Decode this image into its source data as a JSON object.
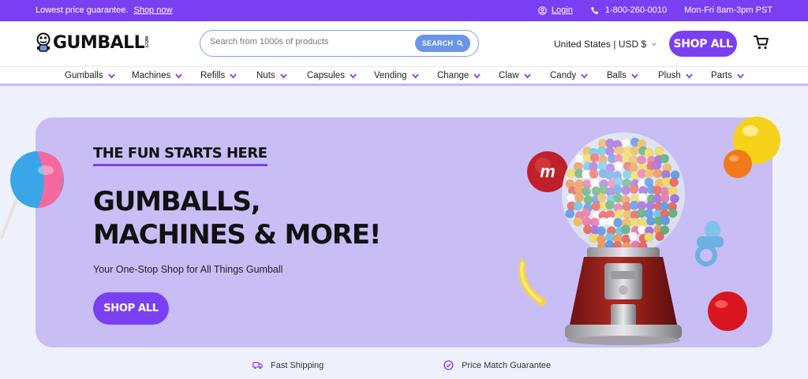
{
  "topbar": {
    "promo_text": "Lowest price guarantee.",
    "promo_link": "Shop now",
    "login": "Login",
    "phone": "1-800-260-0010",
    "hours": "Mon-Fri 8am-3pm PST"
  },
  "header": {
    "logo_text": "GUMBALL",
    "logo_suffix": ".COM",
    "search_placeholder": "Search from 1000s of products",
    "search_button": "SEARCH",
    "region": "United States | USD $",
    "shop_all": "SHOP ALL"
  },
  "nav": {
    "categories": [
      "Gumballs",
      "Machines",
      "Refills",
      "Nuts",
      "Capsules",
      "Vending",
      "Change",
      "Claw",
      "Candy",
      "Balls",
      "Plush",
      "Parts"
    ]
  },
  "hero": {
    "eyebrow": "THE FUN STARTS HERE",
    "headline": "GUMBALLS, MACHINES & MORE!",
    "subline": "Your One-Stop Shop for All Things Gumball",
    "button": "SHOP ALL",
    "candy_letter": "m"
  },
  "features": [
    {
      "label": "Fast Shipping",
      "icon": "truck-icon"
    },
    {
      "label": "Price Match Guarantee",
      "icon": "check-circle-icon"
    }
  ],
  "colors": {
    "brand_purple": "#7b3ff2",
    "hero_bg": "#c9bdf6",
    "search_blue": "#6b95e6",
    "page_bg": "#eef1fb"
  }
}
